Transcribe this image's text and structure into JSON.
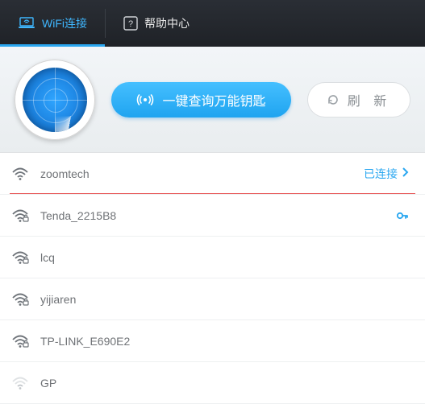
{
  "tabs": {
    "wifi_label": "WiFi连接",
    "help_label": "帮助中心"
  },
  "header": {
    "query_button_label": "一键查询万能钥匙",
    "refresh_button_label": "刷 新"
  },
  "networks": [
    {
      "ssid": "zoomtech",
      "signal": "strong",
      "locked": false,
      "connected": true,
      "status_label": "已连接",
      "has_key": false
    },
    {
      "ssid": "Tenda_2215B8",
      "signal": "strong",
      "locked": true,
      "connected": false,
      "status_label": "",
      "has_key": true
    },
    {
      "ssid": "lcq",
      "signal": "strong",
      "locked": true,
      "connected": false,
      "status_label": "",
      "has_key": false
    },
    {
      "ssid": "yijiaren",
      "signal": "strong",
      "locked": true,
      "connected": false,
      "status_label": "",
      "has_key": false
    },
    {
      "ssid": "TP-LINK_E690E2",
      "signal": "strong",
      "locked": true,
      "connected": false,
      "status_label": "",
      "has_key": false
    },
    {
      "ssid": "GP",
      "signal": "weak",
      "locked": false,
      "connected": false,
      "status_label": "",
      "has_key": false
    }
  ],
  "colors": {
    "accent": "#2aa7f0",
    "tab_bg": "#24272d",
    "connected_underline": "#e85a5a"
  }
}
